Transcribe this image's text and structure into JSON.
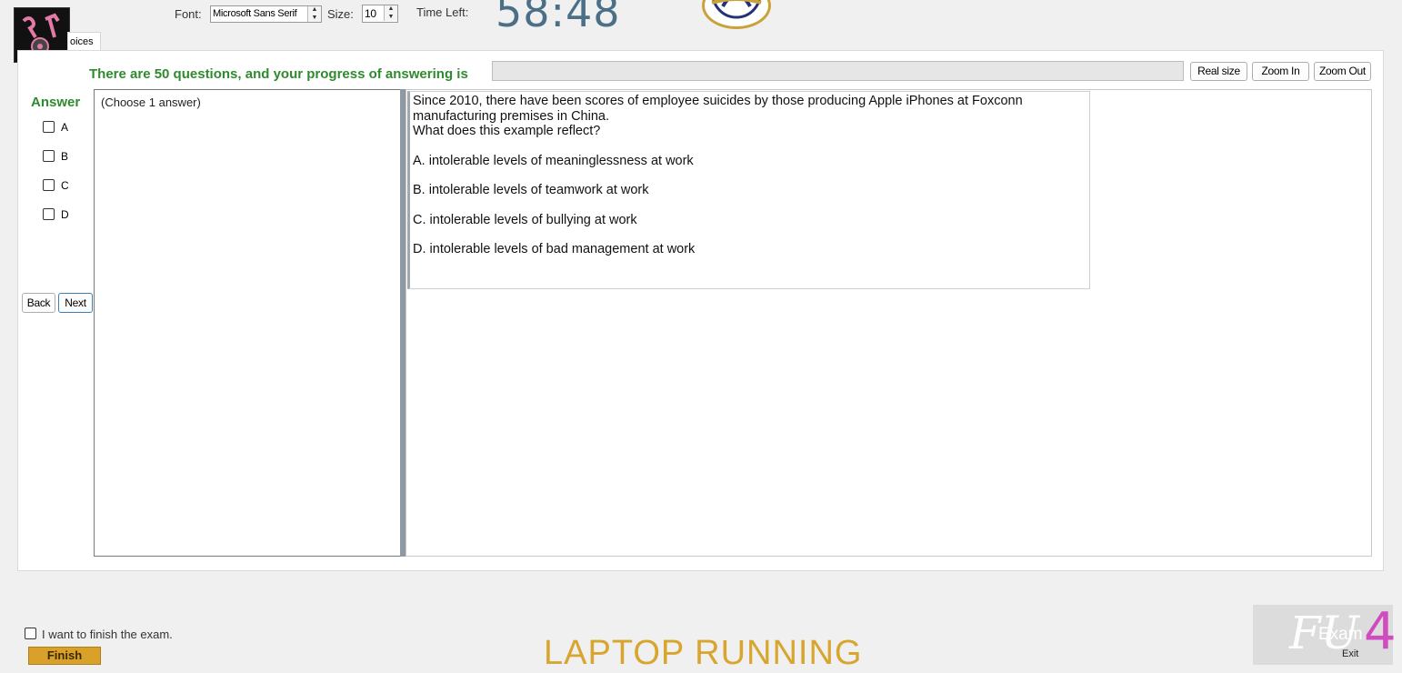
{
  "toolbar": {
    "font_label": "Font:",
    "font_value": "Microsoft Sans Serif",
    "size_label": "Size:",
    "size_value": "10",
    "time_label": "Time Left:",
    "time_value": "58:48"
  },
  "tab": {
    "label": "oices"
  },
  "progress": {
    "label": "There are 50 questions, and your progress of answering is",
    "value": 0
  },
  "zoom": {
    "real_size": "Real size",
    "zoom_in": "Zoom In",
    "zoom_out": "Zoom Out"
  },
  "answer": {
    "title": "Answer",
    "options": [
      "A",
      "B",
      "C",
      "D"
    ],
    "back": "Back",
    "next": "Next"
  },
  "choices": {
    "hint": "(Choose 1 answer)"
  },
  "question": {
    "line1": "Since 2010, there have been scores of employee suicides by those producing Apple iPhones at Foxconn",
    "line2": "manufacturing premises in China.",
    "line3": "What does this example reflect?",
    "options": [
      "A.  intolerable levels of meaninglessness at work",
      "B.  intolerable levels of teamwork at work",
      "C.  intolerable levels of bullying at work",
      "D.  intolerable levels of bad management at work"
    ]
  },
  "footer": {
    "finish_check_label": "I want to finish the exam.",
    "finish_button": "Finish",
    "banner": "LAPTOP RUNNING",
    "exit_label": "Exit",
    "exit_brand_exam": "Exam",
    "exit_brand_num": "4"
  },
  "colors": {
    "accent_green": "#2f8a2f",
    "clock": "#4a6f86",
    "finish": "#d9a02a",
    "banner": "#d8a52f"
  }
}
